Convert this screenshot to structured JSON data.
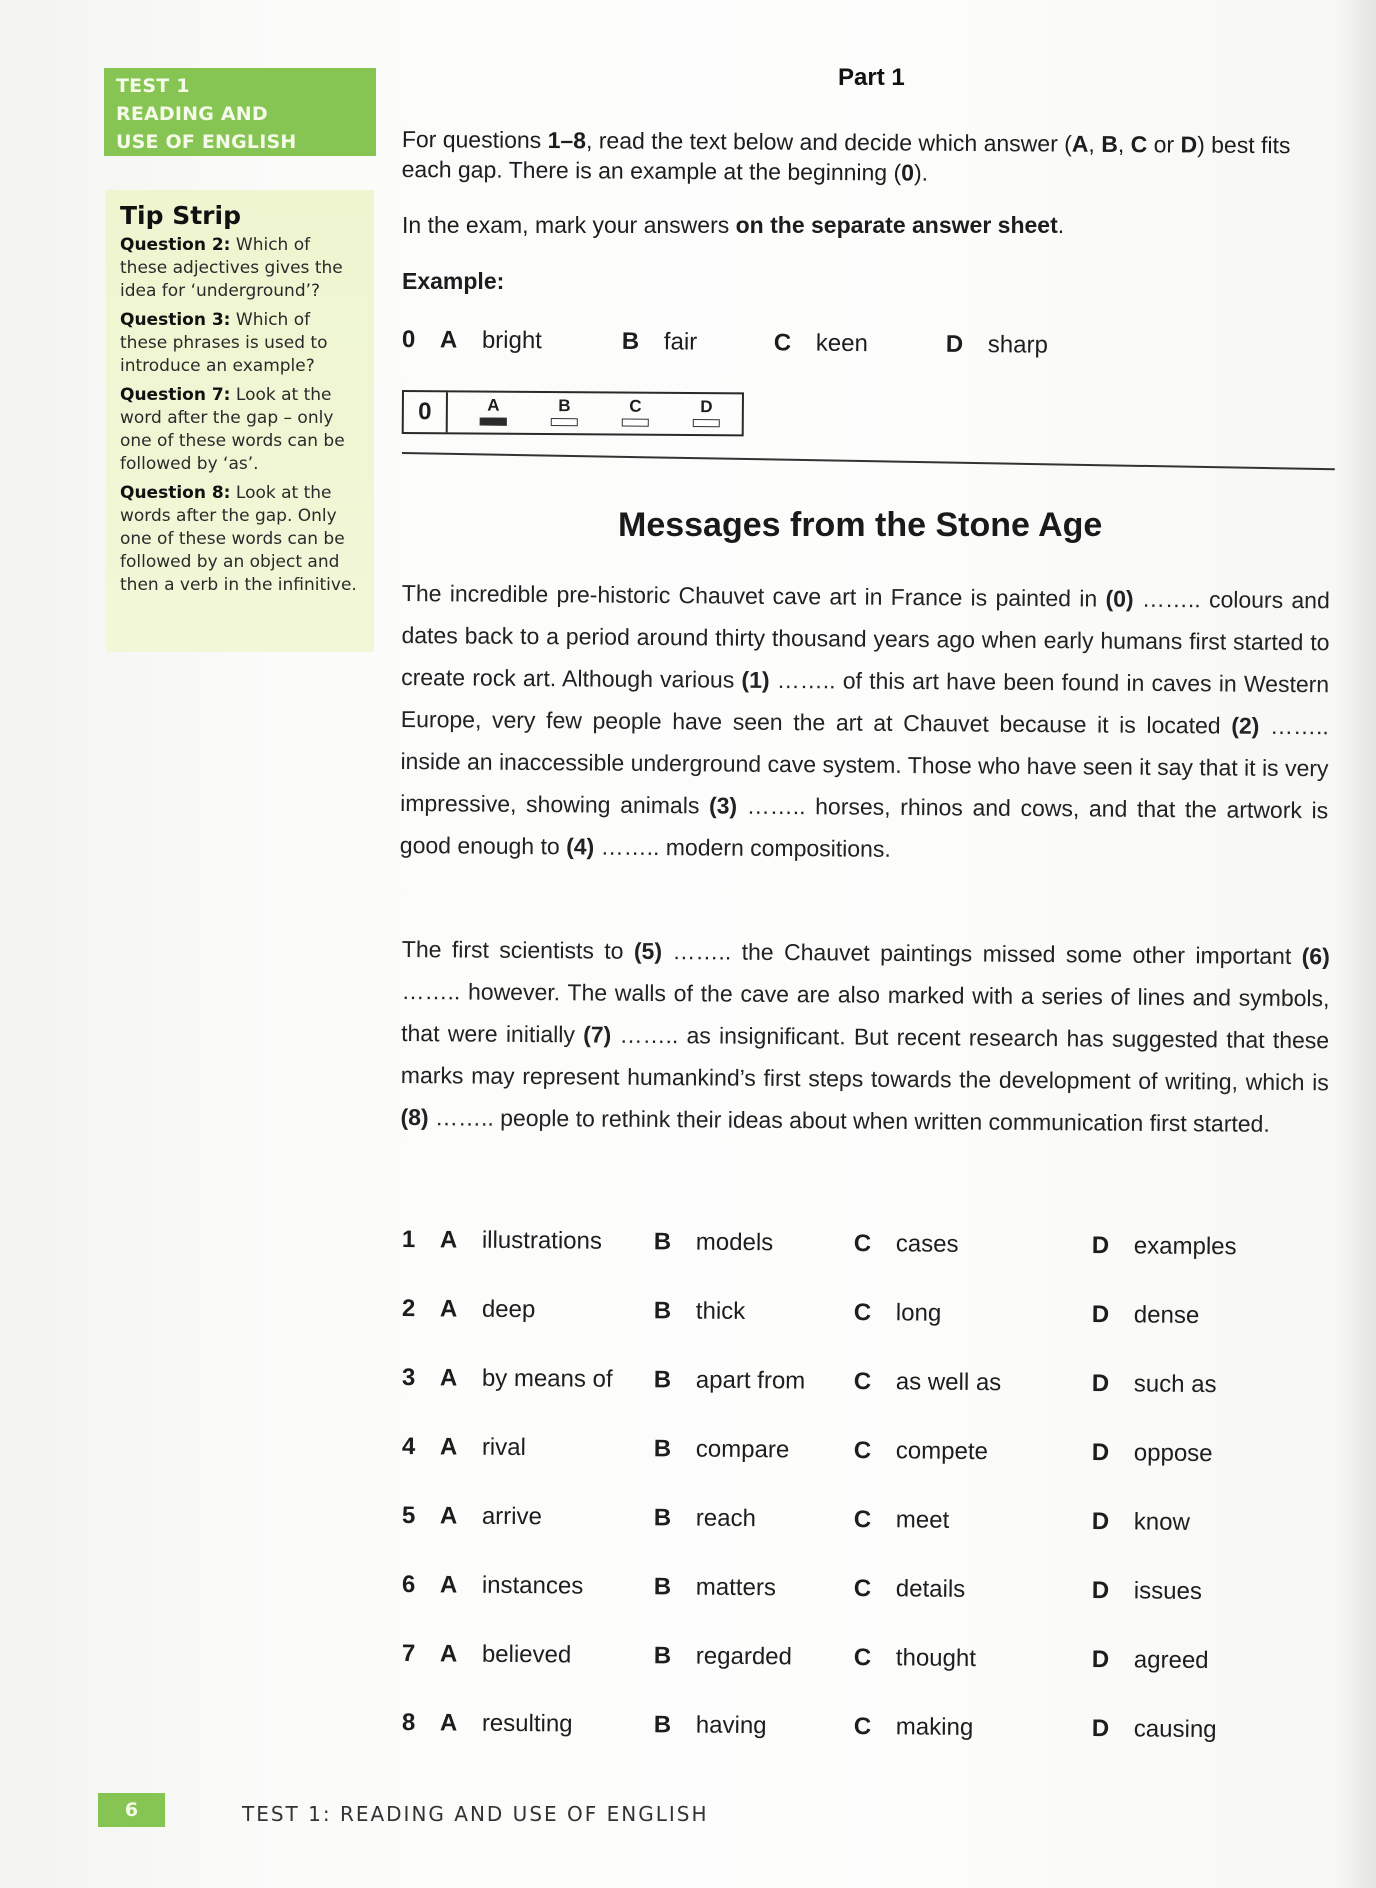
{
  "sidebar": {
    "banner": [
      "TEST 1",
      "READING AND",
      "USE OF ENGLISH"
    ],
    "tip_strip": {
      "title": "Tip Strip",
      "items": [
        {
          "label": "Question 2:",
          "text": "Which of these adjectives gives the idea for ‘underground’?"
        },
        {
          "label": "Question 3:",
          "text": "Which of these phrases is used to introduce an example?"
        },
        {
          "label": "Question 7:",
          "text": "Look at the word after the gap – only one of these words can be followed by ‘as’."
        },
        {
          "label": "Question 8:",
          "text": "Look at the words after the gap. Only one of these words can be followed by an object and then a verb in the infinitive."
        }
      ]
    }
  },
  "header": {
    "part_title": "Part 1"
  },
  "instructions": {
    "line1_pre": "For questions ",
    "line1_range": "1–8",
    "line1_mid": ", read the text below and decide which answer (",
    "a": "A",
    "b": "B",
    "c": "C",
    "or": " or ",
    "d": "D",
    "line1_post": ") best fits each gap. There is an example at the beginning (",
    "zero": "0",
    "line1_end": ").",
    "line2_pre": "In the exam, mark your answers ",
    "line2_bold": "on the separate answer sheet",
    "line2_end": "."
  },
  "example": {
    "label": "Example:",
    "number": "0",
    "options": [
      {
        "letter": "A",
        "word": "bright"
      },
      {
        "letter": "B",
        "word": "fair"
      },
      {
        "letter": "C",
        "word": "keen"
      },
      {
        "letter": "D",
        "word": "sharp"
      }
    ],
    "answer_box": {
      "number": "0",
      "choices": [
        "A",
        "B",
        "C",
        "D"
      ],
      "selected": "A"
    }
  },
  "article": {
    "title": "Messages from the Stone Age",
    "paragraphs": [
      [
        {
          "t": "The incredible pre-historic Chauvet cave art in France is painted in "
        },
        {
          "b": "(0)"
        },
        {
          "t": " …….. colours and dates back to a period around thirty thousand years ago when early humans first started to create rock art. Although various "
        },
        {
          "b": "(1)"
        },
        {
          "t": " …….. of this art have been found in caves in Western Europe, very few people have seen the art at Chauvet because it is located "
        },
        {
          "b": "(2)"
        },
        {
          "t": " …….. inside an inaccessible underground cave system. Those who have seen it say that it is very impressive, showing animals "
        },
        {
          "b": "(3)"
        },
        {
          "t": " …….. horses, rhinos and cows, and that the artwork is good enough to "
        },
        {
          "b": "(4)"
        },
        {
          "t": " …….. modern compositions."
        }
      ],
      [
        {
          "t": "The first scientists to "
        },
        {
          "b": "(5)"
        },
        {
          "t": " …….. the Chauvet paintings missed some other important "
        },
        {
          "b": "(6)"
        },
        {
          "t": " …….. however. The walls of the cave are also marked with a series of lines and symbols, that were initially "
        },
        {
          "b": "(7)"
        },
        {
          "t": " …….. as insignificant. But recent research has suggested that these marks may represent humankind’s first steps towards the development of writing, which is "
        },
        {
          "b": "(8)"
        },
        {
          "t": " …….. people to rethink their ideas about when written communication first started."
        }
      ]
    ]
  },
  "questions": [
    {
      "number": "1",
      "options": [
        {
          "letter": "A",
          "word": "illustrations"
        },
        {
          "letter": "B",
          "word": "models"
        },
        {
          "letter": "C",
          "word": "cases"
        },
        {
          "letter": "D",
          "word": "examples"
        }
      ]
    },
    {
      "number": "2",
      "options": [
        {
          "letter": "A",
          "word": "deep"
        },
        {
          "letter": "B",
          "word": "thick"
        },
        {
          "letter": "C",
          "word": "long"
        },
        {
          "letter": "D",
          "word": "dense"
        }
      ]
    },
    {
      "number": "3",
      "options": [
        {
          "letter": "A",
          "word": "by means of"
        },
        {
          "letter": "B",
          "word": "apart from"
        },
        {
          "letter": "C",
          "word": "as well as"
        },
        {
          "letter": "D",
          "word": "such as"
        }
      ]
    },
    {
      "number": "4",
      "options": [
        {
          "letter": "A",
          "word": "rival"
        },
        {
          "letter": "B",
          "word": "compare"
        },
        {
          "letter": "C",
          "word": "compete"
        },
        {
          "letter": "D",
          "word": "oppose"
        }
      ]
    },
    {
      "number": "5",
      "options": [
        {
          "letter": "A",
          "word": "arrive"
        },
        {
          "letter": "B",
          "word": "reach"
        },
        {
          "letter": "C",
          "word": "meet"
        },
        {
          "letter": "D",
          "word": "know"
        }
      ]
    },
    {
      "number": "6",
      "options": [
        {
          "letter": "A",
          "word": "instances"
        },
        {
          "letter": "B",
          "word": "matters"
        },
        {
          "letter": "C",
          "word": "details"
        },
        {
          "letter": "D",
          "word": "issues"
        }
      ]
    },
    {
      "number": "7",
      "options": [
        {
          "letter": "A",
          "word": "believed"
        },
        {
          "letter": "B",
          "word": "regarded"
        },
        {
          "letter": "C",
          "word": "thought"
        },
        {
          "letter": "D",
          "word": "agreed"
        }
      ]
    },
    {
      "number": "8",
      "options": [
        {
          "letter": "A",
          "word": "resulting"
        },
        {
          "letter": "B",
          "word": "having"
        },
        {
          "letter": "C",
          "word": "making"
        },
        {
          "letter": "D",
          "word": "causing"
        }
      ]
    }
  ],
  "footer": {
    "page_number": "6",
    "running_title": "TEST 1: READING AND USE OF ENGLISH"
  }
}
